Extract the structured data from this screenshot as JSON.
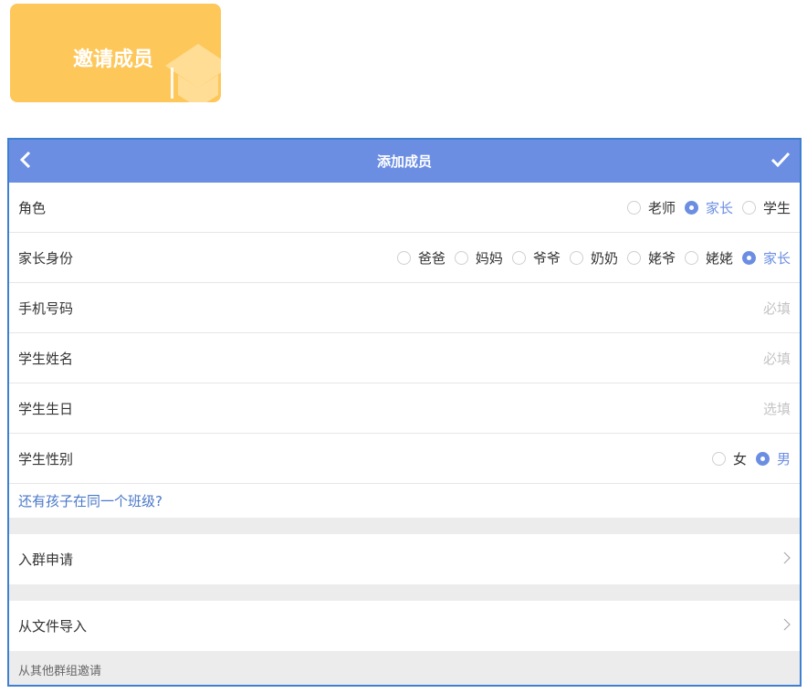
{
  "invite_card": {
    "label": "邀请成员"
  },
  "header": {
    "title": "添加成员"
  },
  "rows": {
    "role": {
      "label": "角色",
      "options": [
        "老师",
        "家长",
        "学生"
      ],
      "selected": "家长"
    },
    "parent_identity": {
      "label": "家长身份",
      "options": [
        "爸爸",
        "妈妈",
        "爷爷",
        "奶奶",
        "姥爷",
        "姥姥",
        "家长"
      ],
      "selected": "家长"
    },
    "phone": {
      "label": "手机号码",
      "placeholder": "必填"
    },
    "student_name": {
      "label": "学生姓名",
      "placeholder": "必填"
    },
    "student_birthday": {
      "label": "学生生日",
      "placeholder": "选填"
    },
    "student_gender": {
      "label": "学生性别",
      "options": [
        "女",
        "男"
      ],
      "selected": "男"
    }
  },
  "more_children_link": "还有孩子在同一个班级?",
  "group_request": {
    "label": "入群申请"
  },
  "import_file": {
    "label": "从文件导入"
  },
  "invite_other_groups": {
    "label": "从其他群组邀请"
  },
  "colors": {
    "accent": "#6b8ee3",
    "card": "#fdc75a",
    "border": "#3e7fd0"
  },
  "icons": [
    "back-arrow-icon",
    "checkmark-icon",
    "chevron-right-icon",
    "graduation-cap-icon"
  ]
}
